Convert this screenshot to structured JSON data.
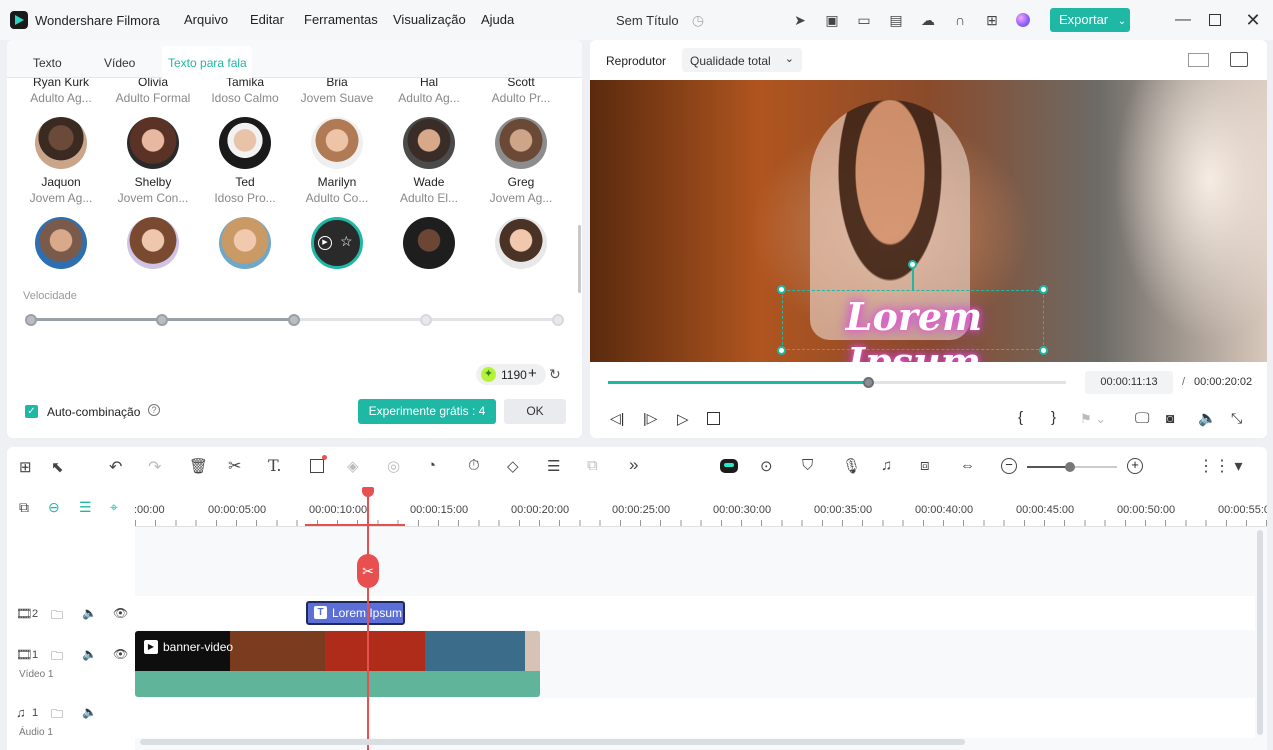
{
  "app": {
    "name": "Wondershare Filmora",
    "project_title": "Sem Título"
  },
  "menu": [
    "Arquivo",
    "Editar",
    "Ferramentas",
    "Visualização",
    "Ajuda"
  ],
  "export_label": "Exportar",
  "left_tabs": [
    "Texto",
    "Vídeo",
    "Texto para fala"
  ],
  "voices_row0": [
    {
      "name": "Ryan Kurk",
      "desc": "Adulto Ag..."
    },
    {
      "name": "Olivia",
      "desc": "Adulto Formal"
    },
    {
      "name": "Tamika",
      "desc": "Idoso Calmo"
    },
    {
      "name": "Bria",
      "desc": "Jovem Suave"
    },
    {
      "name": "Hal",
      "desc": "Adulto Ag..."
    },
    {
      "name": "Scott",
      "desc": "Adulto Pr..."
    }
  ],
  "voices_row1": [
    {
      "name": "Jaquon",
      "desc": "Jovem Ag..."
    },
    {
      "name": "Shelby",
      "desc": "Jovem Con..."
    },
    {
      "name": "Ted",
      "desc": "Idoso Pro..."
    },
    {
      "name": "Marilyn",
      "desc": "Adulto Co..."
    },
    {
      "name": "Wade",
      "desc": "Adulto El..."
    },
    {
      "name": "Greg",
      "desc": "Jovem Ag..."
    }
  ],
  "speed_label": "Velocidade",
  "speed_level_index": 2,
  "credits": "1190",
  "auto_match_label": "Auto-combinação",
  "try_free_label": "Experimente grátis : 4",
  "ok_label": "OK",
  "player": {
    "label": "Reprodutor",
    "quality": "Qualidade total",
    "overlay_text": "Lorem Ipsum",
    "current_time": "00:00:11:13",
    "separator": "/",
    "total_time": "00:00:20:02",
    "progress": 0.57
  },
  "timeline": {
    "ruler": [
      ":00:00",
      "00:00:05:00",
      "00:00:10:00",
      "00:00:15:00",
      "00:00:20:00",
      "00:00:25:00",
      "00:00:30:00",
      "00:00:35:00",
      "00:00:40:00",
      "00:00:45:00",
      "00:00:50:00",
      "00:00:55:0"
    ],
    "track2_num": "2",
    "track1_num": "1",
    "track1_label": "Vídeo 1",
    "audio_num": "1",
    "audio_label": "Áudio 1",
    "text_clip": "Lorem Ipsum",
    "video_clip": "banner-video"
  },
  "colors": {
    "accent": "#1fb8a5",
    "playhead": "#e8504f",
    "video_clip": "#5fb49a",
    "text_clip": "#5b6fd6"
  }
}
